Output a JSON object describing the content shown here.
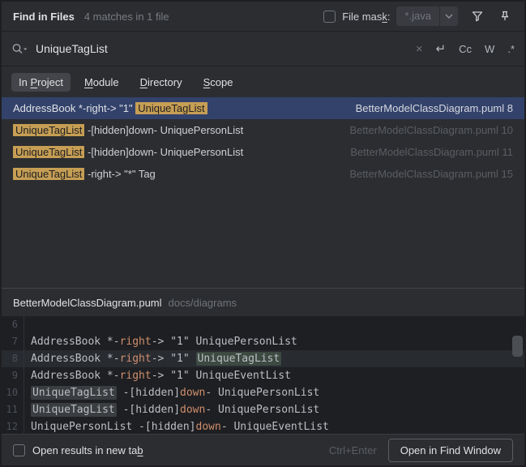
{
  "colors": {
    "selection_blue": "#33426B",
    "match_highlight": "#C69E54",
    "keyword_orange": "#CF8E6D",
    "panel_bg": "#2B2D30",
    "editor_bg": "#1E1F22"
  },
  "header": {
    "title": "Find in Files",
    "summary": "4 matches in 1 file",
    "file_mask": {
      "label_pre": "File mas",
      "label_key": "k",
      "label_post": ":",
      "value": "*.java"
    }
  },
  "search": {
    "query": "UniqueTagList",
    "clear_icon": "×",
    "newline_icon": "↵",
    "match_case": "Cc",
    "words": "W",
    "regex": ".*"
  },
  "scopes": [
    {
      "pre": "In ",
      "key": "P",
      "rest": "roject"
    },
    {
      "pre": "",
      "key": "M",
      "rest": "odule"
    },
    {
      "pre": "",
      "key": "D",
      "rest": "irectory"
    },
    {
      "pre": "",
      "key": "S",
      "rest": "cope"
    }
  ],
  "results": {
    "rows": [
      {
        "pre": "AddressBook *-right-> \"1\" ",
        "match": "UniqueTagList",
        "post": "",
        "file": "BetterModelClassDiagram.puml",
        "line": "8"
      },
      {
        "pre": "",
        "match": "UniqueTagList",
        "post": " -[hidden]down- UniquePersonList",
        "file": "BetterModelClassDiagram.puml",
        "line": "10"
      },
      {
        "pre": "",
        "match": "UniqueTagList",
        "post": " -[hidden]down- UniquePersonList",
        "file": "BetterModelClassDiagram.puml",
        "line": "11"
      },
      {
        "pre": "",
        "match": "UniqueTagList",
        "post": " -right-> \"*\" Tag",
        "file": "BetterModelClassDiagram.puml",
        "line": "15"
      }
    ]
  },
  "preview": {
    "file": "BetterModelClassDiagram.puml",
    "path": "docs/diagrams",
    "code": [
      {
        "num": "6",
        "a": "",
        "kw": "",
        "b": ""
      },
      {
        "num": "7",
        "a": "AddressBook *-",
        "kw": "right",
        "b": "-> \"1\" UniquePersonList"
      },
      {
        "num": "8",
        "a": "AddressBook *-",
        "kw": "right",
        "b": "-> \"1\" ",
        "match": "UniqueTagList"
      },
      {
        "num": "9",
        "a": "AddressBook *-",
        "kw": "right",
        "b": "-> \"1\" UniqueEventList"
      },
      {
        "num": "10",
        "match": "UniqueTagList",
        "a": " -[hidden]",
        "kw": "down",
        "b": "- UniquePersonList"
      },
      {
        "num": "11",
        "match": "UniqueTagList",
        "a": " -[hidden]",
        "kw": "down",
        "b": "- UniquePersonList"
      },
      {
        "num": "12",
        "a": "UniquePersonList -[hidden]",
        "kw": "down",
        "b": "- UniqueEventList"
      }
    ]
  },
  "footer": {
    "checkbox_pre": "Open results in new ta",
    "checkbox_key": "b",
    "shortcut": "Ctrl+Enter",
    "open_button": "Open in Find Window"
  }
}
